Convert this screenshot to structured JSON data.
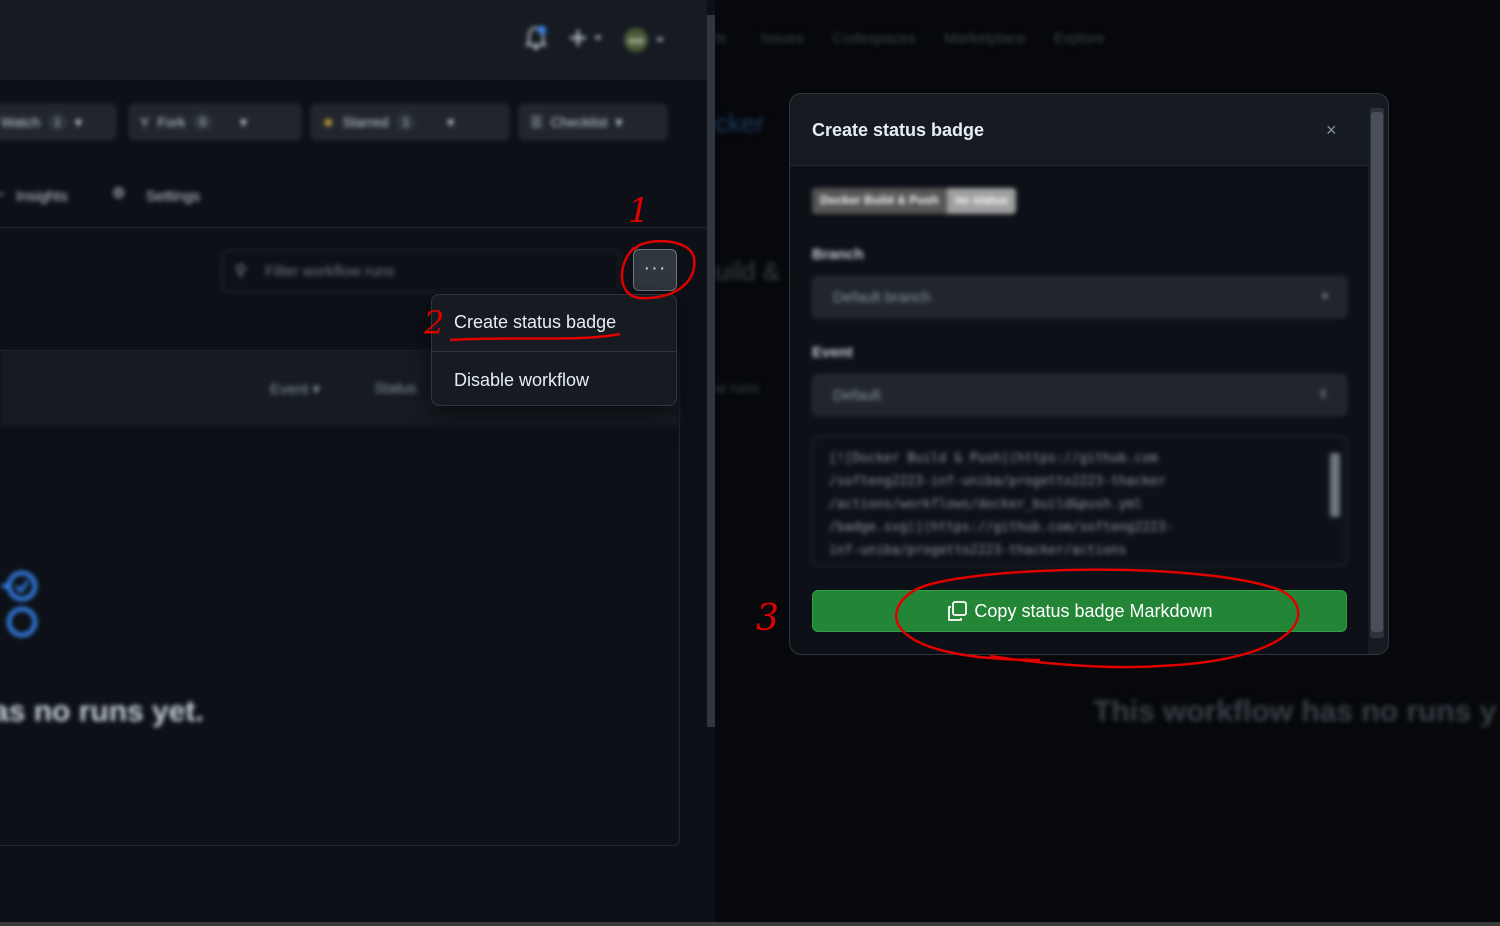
{
  "left": {
    "header_icons": [
      "bell-icon",
      "plus-icon",
      "avatar"
    ],
    "repo_buttons": {
      "watch": {
        "label": "Watch",
        "count": "1"
      },
      "fork": {
        "label": "Fork",
        "count": "0"
      },
      "starred": {
        "label": "Starred",
        "count": "1"
      },
      "checklist": {
        "label": "Checklist"
      }
    },
    "tabs": {
      "insights": "Insights",
      "settings": "Settings"
    },
    "filter_placeholder": "Filter workflow runs",
    "kebab_label": "···",
    "runs_filters": {
      "event": "Event ▾",
      "status": "Status"
    },
    "empty_text": "as no runs yet.",
    "menu": {
      "items": [
        "Create status badge",
        "Disable workflow"
      ]
    }
  },
  "right": {
    "nav": [
      "ts",
      "Issues",
      "Codespaces",
      "Marketplace",
      "Explore"
    ],
    "bg_fragments": {
      "repo_name": "cker",
      "heading": "uild &",
      "runs_label": "w runs",
      "empty_text": "This workflow has no runs y"
    },
    "modal": {
      "title": "Create status badge",
      "close": "×",
      "badge_left": "Docker Build & Push",
      "badge_right": "no status",
      "branch_label": "Branch",
      "branch_value": "Default branch",
      "event_label": "Event",
      "event_value": "Default",
      "markdown": "[![Docker Build & Push](https://github.com/softeng2223-inf-uniba/progetto2223-thacker/actions/workflows/docker_build&push.yml/badge.svg)](https://github.com/softeng2223-inf-uniba/progetto2223-thacker/actions",
      "markdown_lines": [
        "[![Docker Build & Push](https://github.com",
        "/softeng2223-inf-uniba/progetto2223-thacker",
        "/actions/workflows/docker_build&push.yml",
        "/badge.svg)](https://github.com/softeng2223-",
        "inf-uniba/progetto2223-thacker/actions"
      ],
      "copy_button": "Copy status badge Markdown"
    }
  },
  "annotations": {
    "step1": "1",
    "step2": "2",
    "step3": "3",
    "color": "#e00000"
  }
}
